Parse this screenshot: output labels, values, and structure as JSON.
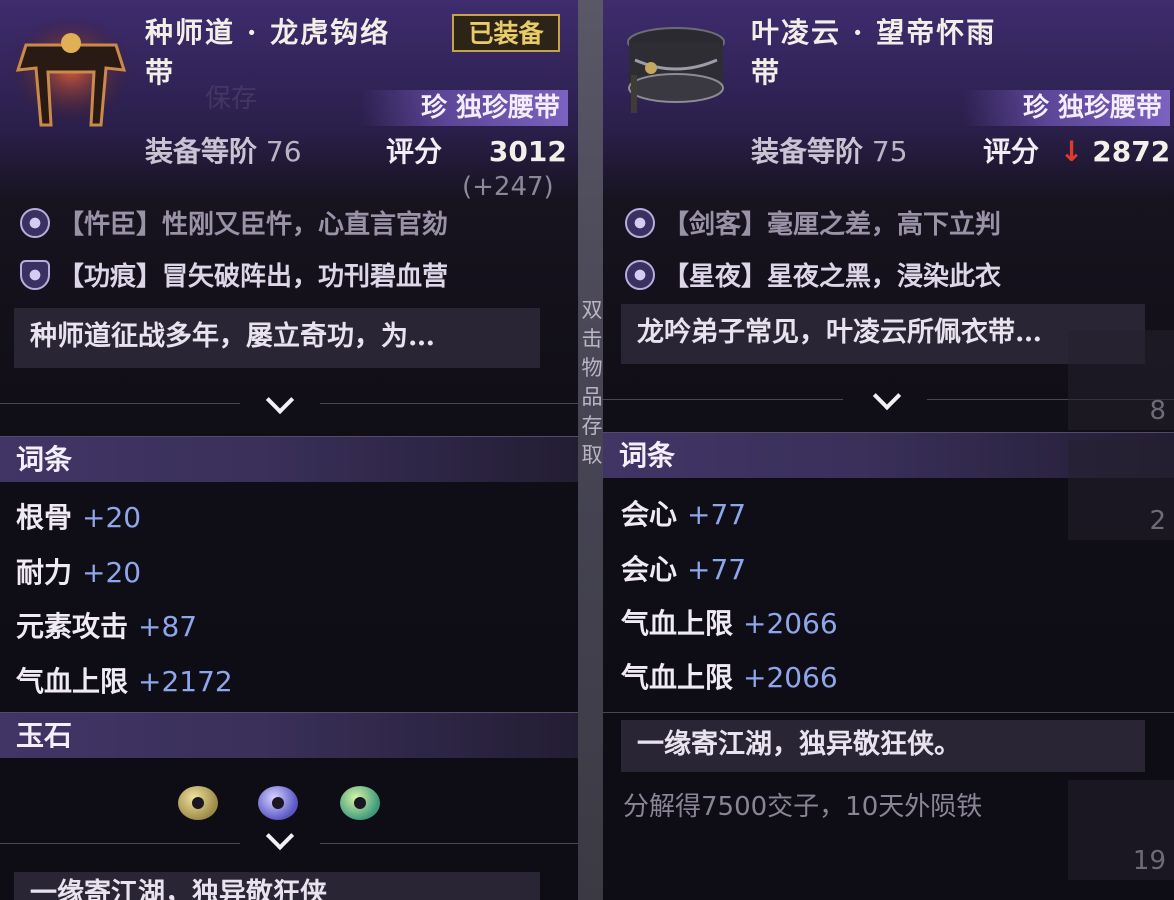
{
  "left": {
    "name_line1": "种师道 · 龙虎钩络",
    "name_line2": "带",
    "equipped": "已装备",
    "rarity": "珍 独珍腰带",
    "tier_label": "装备等阶",
    "tier_value": "76",
    "score_label": "评分",
    "score_value": "3012",
    "score_diff": "(+247)",
    "effects": [
      {
        "text": "【忤臣】性刚又臣忤，心直言官劾"
      },
      {
        "text": "【功痕】冒矢破阵出，功刊碧血营"
      }
    ],
    "description": "种师道征战多年，屡立奇功，为…",
    "affix_title": "词条",
    "affixes": [
      {
        "name": "根骨",
        "value": "+20"
      },
      {
        "name": "耐力",
        "value": "+20"
      },
      {
        "name": "元素攻击",
        "value": "+87"
      },
      {
        "name": "气血上限",
        "value": "+2172"
      }
    ],
    "gem_title": "玉石",
    "bottom_text": "一缘寄江湖，独异敬狂侠"
  },
  "right": {
    "name_line1": "叶凌云 · 望帝怀雨",
    "name_line2": "带",
    "rarity": "珍 独珍腰带",
    "tier_label": "装备等阶",
    "tier_value": "75",
    "score_label": "评分",
    "score_arrow": "↓",
    "score_value": "2872",
    "effects": [
      {
        "text": "【剑客】毫厘之差，高下立判"
      },
      {
        "text": "【星夜】星夜之黑，浸染此衣"
      }
    ],
    "description": "龙吟弟子常见，叶凌云所佩衣带…",
    "affix_title": "词条",
    "affixes": [
      {
        "name": "会心",
        "value": "+77"
      },
      {
        "name": "会心",
        "value": "+77"
      },
      {
        "name": "气血上限",
        "value": "+2066"
      },
      {
        "name": "气血上限",
        "value": "+2066"
      }
    ],
    "flavor": "一缘寄江湖，独异敬狂侠。",
    "salvage": "分解得7500交子，10天外陨铁"
  },
  "side_hint": "双击物品存取",
  "ghost_text": "保存",
  "inventory_counts": [
    "8",
    "2",
    "19"
  ],
  "colors": {
    "accent_purple": "#3e2c6e",
    "stat_blue": "#8ea6ea",
    "equipped_gold": "#c4a447",
    "decrease_red": "#e03a2a"
  },
  "icons": [
    "belt-icon",
    "chevron-down-icon",
    "gem-icon",
    "effect-icon"
  ]
}
